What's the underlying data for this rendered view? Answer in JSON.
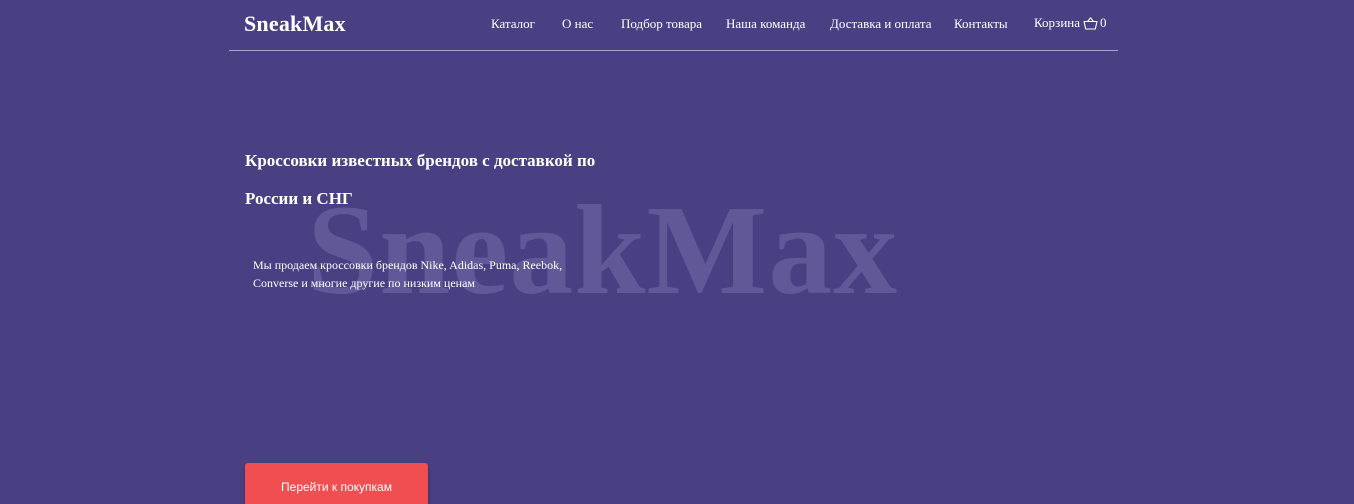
{
  "brand": {
    "logo": "SneakMax",
    "watermark": "SneakMax"
  },
  "nav": {
    "items": [
      {
        "label": "Каталог"
      },
      {
        "label": "О нас"
      },
      {
        "label": "Подбор товара"
      },
      {
        "label": "Наша команда"
      },
      {
        "label": "Доставка и оплата"
      },
      {
        "label": "Контакты"
      }
    ],
    "cart": {
      "label": "Корзина",
      "count": "0",
      "icon": "basket-icon"
    }
  },
  "hero": {
    "title_line1": "Кроссовки известных брендов с доставкой по",
    "title_line2": "России и СНГ",
    "subtitle_line1": "Мы продаем кроссовки брендов Nike, Adidas, Puma, Reebok,",
    "subtitle_line2": "Converse и многие другие по низким ценам",
    "cta_label": "Перейти к покупкам"
  },
  "colors": {
    "background": "#484083",
    "accent": "#f04e50",
    "watermark": "#6a62a0"
  }
}
